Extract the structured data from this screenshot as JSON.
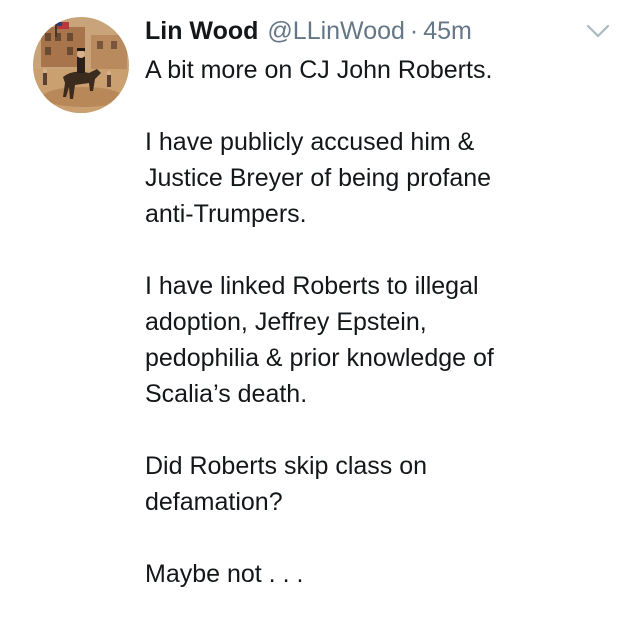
{
  "tweet": {
    "author_name": "Lin Wood",
    "handle": "@LLinWood",
    "separator": "·",
    "time": "45m",
    "menu_icon": "chevron-down-icon",
    "avatar_icon": "avatar-painting-horse-rider",
    "paragraphs": [
      [
        "A bit more on CJ John Roberts."
      ],
      [
        "I have publicly accused him &",
        "Justice Breyer of being profane",
        "anti-Trumpers."
      ],
      [
        "I have linked Roberts to illegal",
        "adoption, Jeffrey Epstein,",
        "pedophilia & prior knowledge of",
        "Scalia’s death."
      ],
      [
        "Did Roberts skip class on",
        "defamation?"
      ],
      [
        "Maybe not . . ."
      ]
    ]
  },
  "colors": {
    "text": "#14171a",
    "secondary": "#657786",
    "chevron": "#aab8c2"
  }
}
